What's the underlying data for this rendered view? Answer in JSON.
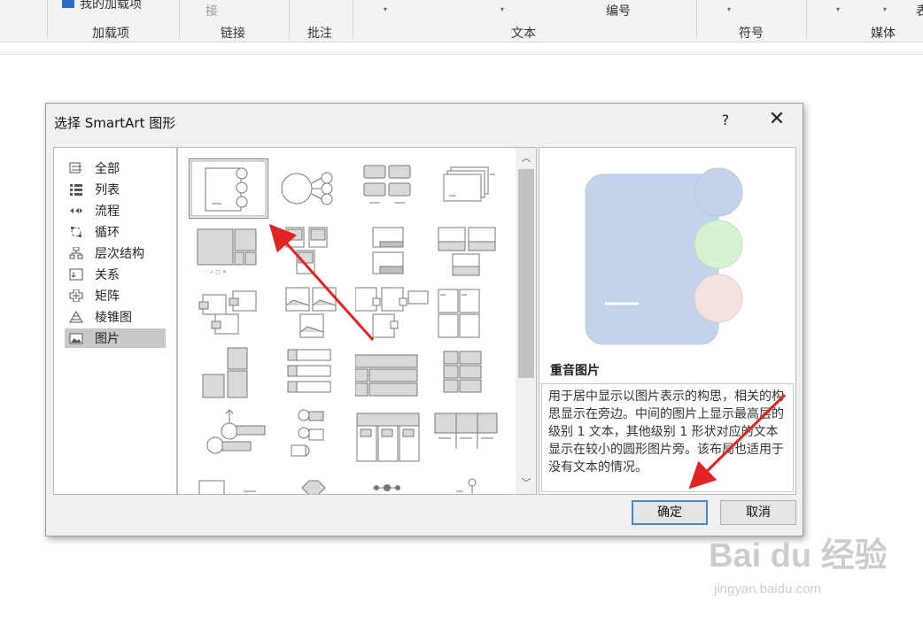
{
  "ribbon": {
    "top_left_fragment": "我的加载项",
    "link_fragment": "接",
    "number_fragment": "编号",
    "right_fragment": "表",
    "groups": [
      "加载项",
      "链接",
      "批注",
      "文本",
      "符号",
      "媒体"
    ]
  },
  "dialog": {
    "title": "选择 SmartArt 图形",
    "help": "?",
    "close": "✕",
    "categories": [
      {
        "label": "全部",
        "icon": "all-icon"
      },
      {
        "label": "列表",
        "icon": "list-icon"
      },
      {
        "label": "流程",
        "icon": "process-icon"
      },
      {
        "label": "循环",
        "icon": "cycle-icon"
      },
      {
        "label": "层次结构",
        "icon": "hierarchy-icon"
      },
      {
        "label": "关系",
        "icon": "relationship-icon"
      },
      {
        "label": "矩阵",
        "icon": "matrix-icon"
      },
      {
        "label": "棱锥图",
        "icon": "pyramid-icon"
      },
      {
        "label": "图片",
        "icon": "picture-icon",
        "selected": true
      }
    ],
    "preview": {
      "title": "重音图片",
      "description": "用于居中显示以图片表示的构思，相关的构思显示在旁边。中间的图片上显示最高层的级别 1 文本，其他级别 1 形状对应的文本显示在较小的圆形图片旁。该布局也适用于没有文本的情况。",
      "colors": {
        "main": "#c3d3ec",
        "circle1": "#c3d3ec",
        "circle2": "#d5f2d2",
        "circle3": "#f6e1e1"
      }
    },
    "ok_label": "确定",
    "cancel_label": "取消"
  },
  "watermark": {
    "brand": "Bai du 经验",
    "url": "jingyan.baidu.com"
  }
}
